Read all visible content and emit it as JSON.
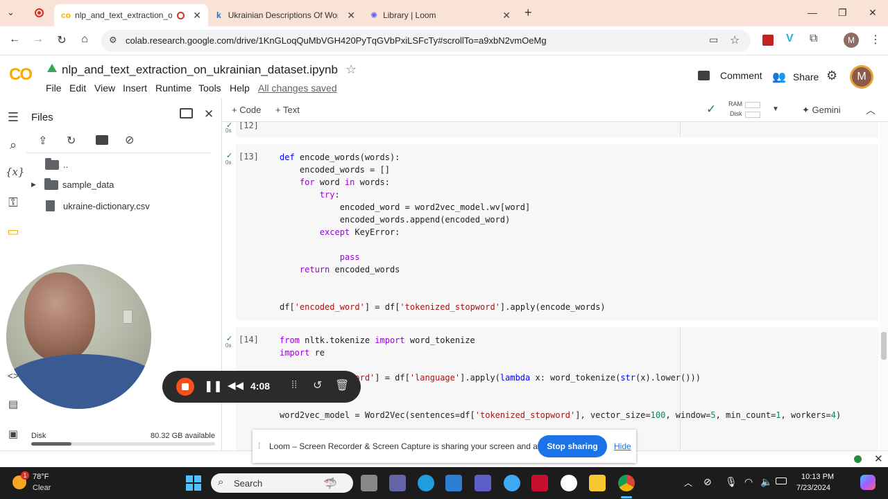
{
  "browser": {
    "tabs": [
      {
        "title": "nlp_and_text_extraction_on_",
        "active": true
      },
      {
        "title": "Ukrainian Descriptions Of Word",
        "active": false
      },
      {
        "title": "Library | Loom",
        "active": false
      }
    ],
    "new_tab": "+",
    "url": "colab.research.google.com/drive/1KnGLoqQuMbVGH420PyTqGVbPxiLSFcTy#scrollTo=a9xbN2vmOeMg",
    "profile_initial": "M"
  },
  "colab": {
    "logo": "CO",
    "notebook_title": "nlp_and_text_extraction_on_ukrainian_dataset.ipynb",
    "menu": [
      "File",
      "Edit",
      "View",
      "Insert",
      "Runtime",
      "Tools",
      "Help"
    ],
    "save_status": "All changes saved",
    "comment_label": "Comment",
    "share_label": "Share",
    "avatar_initial": "M"
  },
  "toolbar": {
    "code_label": "Code",
    "text_label": "Text",
    "ram_label": "RAM",
    "disk_label": "Disk",
    "gemini_label": "Gemini"
  },
  "files_panel": {
    "title": "Files",
    "items": [
      {
        "name": "..",
        "type": "folder"
      },
      {
        "name": "sample_data",
        "type": "folder"
      },
      {
        "name": "ukraine-dictionary.csv",
        "type": "file"
      }
    ],
    "disk_label": "Disk",
    "disk_available": "80.32 GB available",
    "disk_used_fraction": 0.22
  },
  "cells": [
    {
      "prompt": "[12]",
      "time": "0s"
    },
    {
      "prompt": "[13]",
      "time": "0s"
    },
    {
      "prompt": "[14]",
      "time": "0s"
    }
  ],
  "loom": {
    "timer": "4:08",
    "share_message": "Loom – Screen Recorder & Screen Capture is sharing your screen and audio.",
    "stop_label": "Stop sharing",
    "hide_label": "Hide"
  },
  "taskbar": {
    "weather_temp": "78°F",
    "weather_desc": "Clear",
    "weather_badge": "1",
    "search_placeholder": "Search",
    "time": "10:13 PM",
    "date": "7/23/2024"
  },
  "colors": {
    "tab_strip": "#f9e2d6",
    "colab_orange": "#f9ab00",
    "stop_button": "#1a73e8",
    "record_red": "#f4511e",
    "check_green": "#188038"
  }
}
